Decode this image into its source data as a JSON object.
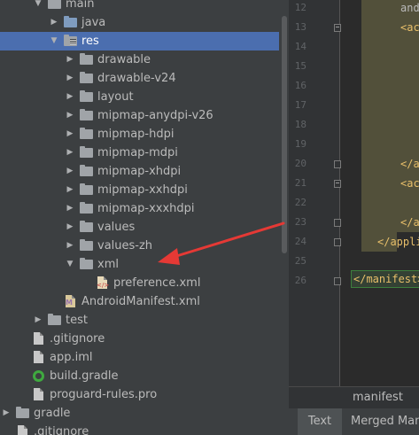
{
  "project_tree": {
    "items": [
      {
        "label": "main",
        "depth": 2,
        "expanded": true,
        "type": "folder"
      },
      {
        "label": "java",
        "depth": 3,
        "expanded": false,
        "type": "folder-blue"
      },
      {
        "label": "res",
        "depth": 3,
        "expanded": true,
        "type": "res-folder",
        "selected": true
      },
      {
        "label": "drawable",
        "depth": 4,
        "expanded": false,
        "type": "folder"
      },
      {
        "label": "drawable-v24",
        "depth": 4,
        "expanded": false,
        "type": "folder"
      },
      {
        "label": "layout",
        "depth": 4,
        "expanded": false,
        "type": "folder"
      },
      {
        "label": "mipmap-anydpi-v26",
        "depth": 4,
        "expanded": false,
        "type": "folder"
      },
      {
        "label": "mipmap-hdpi",
        "depth": 4,
        "expanded": false,
        "type": "folder"
      },
      {
        "label": "mipmap-mdpi",
        "depth": 4,
        "expanded": false,
        "type": "folder"
      },
      {
        "label": "mipmap-xhdpi",
        "depth": 4,
        "expanded": false,
        "type": "folder"
      },
      {
        "label": "mipmap-xxhdpi",
        "depth": 4,
        "expanded": false,
        "type": "folder"
      },
      {
        "label": "mipmap-xxxhdpi",
        "depth": 4,
        "expanded": false,
        "type": "folder"
      },
      {
        "label": "values",
        "depth": 4,
        "expanded": false,
        "type": "folder"
      },
      {
        "label": "values-zh",
        "depth": 4,
        "expanded": false,
        "type": "folder"
      },
      {
        "label": "xml",
        "depth": 4,
        "expanded": true,
        "type": "folder"
      },
      {
        "label": "preference.xml",
        "depth": 5,
        "type": "xml-file"
      },
      {
        "label": "AndroidManifest.xml",
        "depth": 3,
        "type": "manifest-file"
      },
      {
        "label": "test",
        "depth": 2,
        "expanded": false,
        "type": "folder"
      },
      {
        "label": ".gitignore",
        "depth": 1,
        "type": "file"
      },
      {
        "label": "app.iml",
        "depth": 1,
        "type": "file"
      },
      {
        "label": "build.gradle",
        "depth": 1,
        "type": "gradle-file"
      },
      {
        "label": "proguard-rules.pro",
        "depth": 1,
        "type": "file"
      },
      {
        "label": "gradle",
        "depth": 0,
        "expanded": false,
        "type": "folder"
      },
      {
        "label": ".gitignore",
        "depth": 0,
        "type": "file"
      }
    ]
  },
  "editor": {
    "line_numbers": [
      "12",
      "13",
      "14",
      "15",
      "16",
      "17",
      "18",
      "19",
      "20",
      "21",
      "22",
      "23",
      "24",
      "25",
      "26"
    ],
    "code_lines": [
      {
        "line": "12",
        "text": "and",
        "indent": 3,
        "kind": "attr"
      },
      {
        "line": "13",
        "text": "<ac",
        "indent": 3,
        "kind": "tag"
      },
      {
        "line": "20",
        "text": "</a",
        "indent": 3,
        "kind": "tag"
      },
      {
        "line": "21",
        "text": "<ac",
        "indent": 3,
        "kind": "tag"
      },
      {
        "line": "23",
        "text": "</a",
        "indent": 3,
        "kind": "tag"
      },
      {
        "line": "24",
        "text": "</appli",
        "indent": 1,
        "kind": "tag"
      }
    ],
    "closing_tag": "</manifest>",
    "breadcrumb": "manifest",
    "bottom_tabs": [
      "Text",
      "Merged Manifest"
    ]
  },
  "colors": {
    "selection": "#4b6eaf",
    "annotation_arrow": "#e53935",
    "highlight": "#52503a"
  }
}
